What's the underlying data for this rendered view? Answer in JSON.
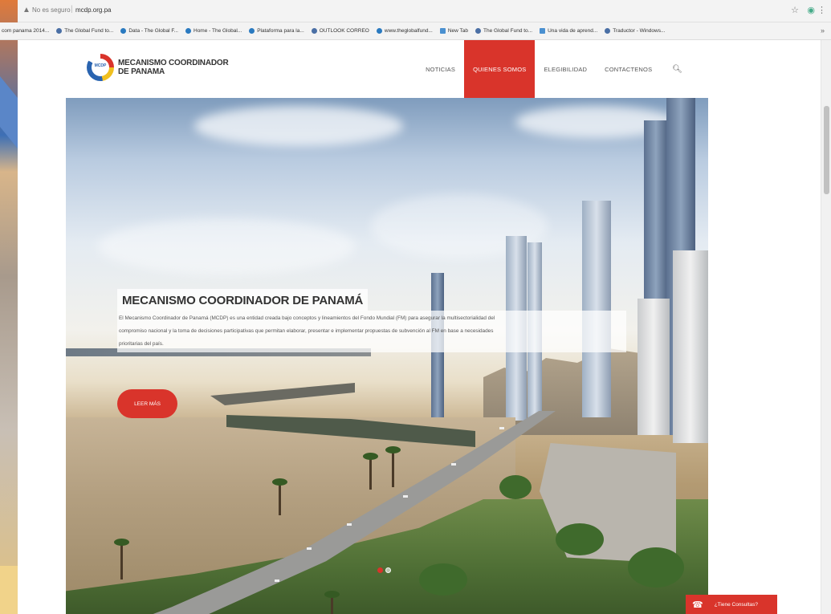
{
  "browser": {
    "security_label": "No es seguro",
    "url": "mcdp.org.pa",
    "bookmarks": [
      {
        "label": "com panama 2014..."
      },
      {
        "label": "The Global Fund to..."
      },
      {
        "label": "Data - The Global F..."
      },
      {
        "label": "Home - The Global..."
      },
      {
        "label": "Plataforma para la..."
      },
      {
        "label": "OUTLOOK CORREO"
      },
      {
        "label": "www.theglobalfund..."
      },
      {
        "label": "New Tab"
      },
      {
        "label": "The Global Fund to..."
      },
      {
        "label": "Una vida de aprend..."
      },
      {
        "label": "Traductor - Windows..."
      }
    ]
  },
  "site": {
    "logo": {
      "mark_text": "MCDP",
      "line1": "MECANISMO COORDINADOR",
      "line2": "DE PANAMA"
    },
    "nav": [
      {
        "label": "NOTICIAS",
        "active": false
      },
      {
        "label": "QUIENES SOMOS",
        "active": true
      },
      {
        "label": "ELEGIBILIDAD",
        "active": false
      },
      {
        "label": "CONTACTENOS",
        "active": false
      }
    ],
    "hero": {
      "title": "MECANISMO COORDINADOR DE PANAMÁ",
      "body_line1": "El Mecanismo Coordinador de Panamá (MCDP) es una entidad creada bajo conceptos y lineamientos del Fondo Mundial (FM) para asegurar la multisectorialidad del",
      "body_line2": "compromiso nacional y la toma de decisiones participativas que permitan elaborar, presentar e implementar propuestas de subvención al FM en base a necesidades",
      "body_line3": "prioritarias del país.",
      "button_label": "LEER MÁS",
      "slide_count": 2,
      "active_slide": 1
    },
    "chat_button_label": "¿Tiene Consultas?"
  },
  "colors": {
    "accent": "#d9342b",
    "nav_text": "#555555"
  }
}
